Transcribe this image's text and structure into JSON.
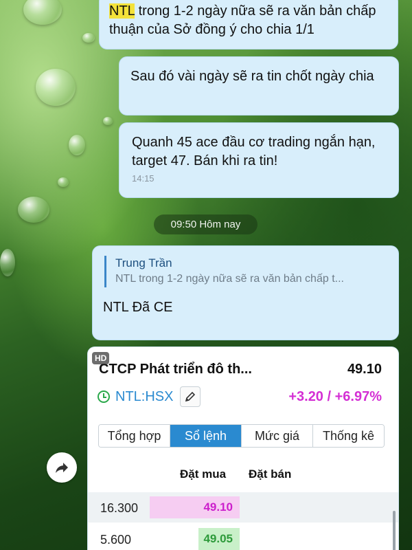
{
  "messages": [
    {
      "highlight": "NTL",
      "text_rest": " trong 1-2 ngày nữa sẽ ra văn bản chấp thuận của Sở đồng ý cho chia 1/1"
    },
    {
      "text": "Sau đó vài ngày sẽ ra tin chốt ngày chia"
    },
    {
      "text": "Quanh 45 ace đầu cơ trading ngắn hạn, target 47. Bán khi ra tin!",
      "time": "14:15"
    }
  ],
  "date_separator": "09:50 Hôm nay",
  "reply_message": {
    "quote_author": "Trung Trần",
    "quote_text": "NTL trong 1-2 ngày nữa sẽ ra văn bản chấp t...",
    "text": "NTL Đã CE"
  },
  "stock_card": {
    "badge": "HD",
    "company": "CTCP Phát triển đô th...",
    "price": "49.10",
    "ticker": "NTL:HSX",
    "change": "+3.20 / +6.97%",
    "colors": {
      "up": "#d42fd4",
      "accent": "#2a8ad0",
      "green": "#2d9a3a"
    },
    "tabs": [
      "Tổng hợp",
      "Sổ lệnh",
      "Mức giá",
      "Thống kê"
    ],
    "active_tab": "Sổ lệnh",
    "columns": {
      "buy": "Đặt mua",
      "sell": "Đặt bán"
    },
    "rows": [
      {
        "volume": "16.300",
        "bid": "49.10"
      },
      {
        "volume": "5.600",
        "bid": "49.05"
      }
    ]
  },
  "icons": {
    "share": "share-arrow-icon",
    "edit": "pencil-icon",
    "clock": "clock-icon"
  }
}
